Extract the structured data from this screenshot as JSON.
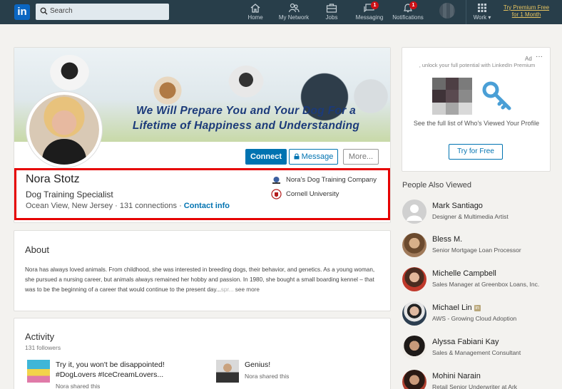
{
  "nav": {
    "logo": "in",
    "search_placeholder": "Search",
    "items": [
      {
        "label": "Home",
        "icon": "home-icon",
        "badge": ""
      },
      {
        "label": "My Network",
        "icon": "network-icon",
        "badge": ""
      },
      {
        "label": "Jobs",
        "icon": "briefcase-icon",
        "badge": ""
      },
      {
        "label": "Messaging",
        "icon": "chat-icon",
        "badge": "1"
      },
      {
        "label": "Notifications",
        "icon": "bell-icon",
        "badge": "1"
      }
    ],
    "work_label": "Work ▾",
    "premium_line1": "Try Premium Free",
    "premium_line2": "for 1 Month"
  },
  "profile": {
    "banner_line1": "We Will Prepare You and Your Dog For a",
    "banner_line2": "Lifetime of Happiness and Understanding",
    "connect_label": "Connect",
    "message_label": "Message",
    "more_label": "More...",
    "name": "Nora Stotz",
    "headline": "Dog Training Specialist",
    "location": "Ocean View, New Jersey",
    "connections": "131 connections",
    "contact_info": "Contact info",
    "company": "Nora's Dog Training Company",
    "school": "Cornell University"
  },
  "about": {
    "title": "About",
    "text": "Nora has always loved animals. From childhood, she was interested in breeding dogs, their behavior, and genetics. As a young woman, she pursued a nursing career, but animals always remained her hobby and passion. In 1980, she bought a small boarding kennel – that was to be the beginning of a career that would continue to the present day...",
    "fade_text": "spr...",
    "see_more": "see more"
  },
  "activity": {
    "title": "Activity",
    "followers": "131 followers",
    "posts": [
      {
        "line1": "Try it, you won't be disappointed!",
        "line2": "#DogLovers #IceCreamLovers...",
        "shared": "Nora shared this"
      },
      {
        "line1": "Genius!",
        "line2": "",
        "shared": "Nora shared this"
      }
    ]
  },
  "ad": {
    "label": "Ad",
    "dots": "···",
    "top_text": ", unlock your full potential with LinkedIn Premium",
    "body": "See the full list of Who's Viewed Your Profile",
    "button": "Try for Free",
    "accent": "#4a9fd6"
  },
  "people_also_viewed": {
    "title": "People Also Viewed",
    "people": [
      {
        "name": "Mark Santiago",
        "title": "Designer & Multimedia Artist",
        "badge": false
      },
      {
        "name": "Bless M.",
        "title": "Senior Mortgage Loan Processor",
        "badge": false
      },
      {
        "name": "Michelle Campbell",
        "title": "Sales Manager at Greenbox Loans, Inc.",
        "badge": false
      },
      {
        "name": "Michael Lin",
        "title": "AWS - Growing Cloud Adoption",
        "badge": true,
        "badge_text": "in"
      },
      {
        "name": "Alyssa Fabiani Kay",
        "title": "Sales & Management Consultant",
        "badge": false
      },
      {
        "name": "Mohini Narain",
        "title": "Retail Senior Underwriter at Ark",
        "badge": false
      }
    ]
  },
  "colors": {
    "nav_bg": "#283e4a",
    "primary": "#0073b1",
    "highlight_border": "#e60000",
    "premium": "#e7c45f"
  }
}
